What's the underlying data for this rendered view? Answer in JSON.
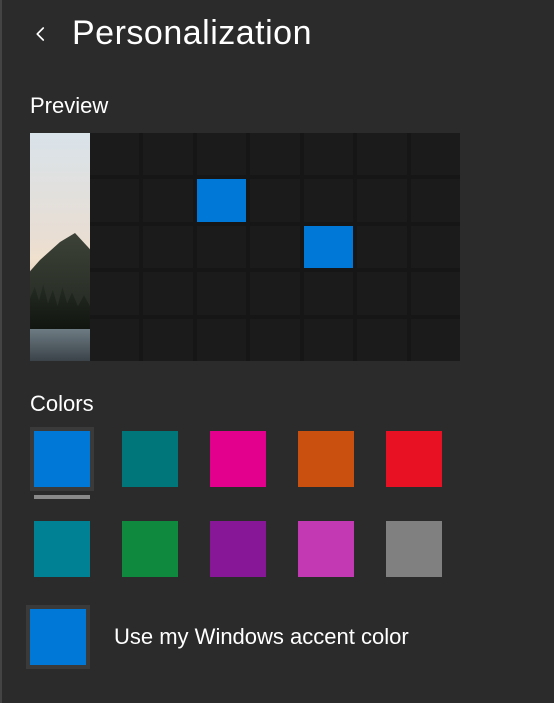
{
  "header": {
    "title": "Personalization"
  },
  "sections": {
    "preview_label": "Preview",
    "colors_label": "Colors"
  },
  "preview": {
    "grid": {
      "cols": 7,
      "rows": 5
    },
    "lit_cells": [
      [
        1,
        2
      ],
      [
        2,
        4
      ]
    ],
    "accent": "#0078d7"
  },
  "colors": {
    "row1": [
      {
        "name": "blue",
        "hex": "#0078d7",
        "selected": true,
        "underline": true
      },
      {
        "name": "teal",
        "hex": "#00757a",
        "selected": false,
        "underline": false
      },
      {
        "name": "magenta",
        "hex": "#e3008c",
        "selected": false,
        "underline": false
      },
      {
        "name": "orange",
        "hex": "#ca5010",
        "selected": false,
        "underline": false
      },
      {
        "name": "red",
        "hex": "#e81123",
        "selected": false,
        "underline": false
      }
    ],
    "row2": [
      {
        "name": "darkteal",
        "hex": "#008294",
        "selected": false
      },
      {
        "name": "green",
        "hex": "#0f893e",
        "selected": false
      },
      {
        "name": "purple",
        "hex": "#881798",
        "selected": false
      },
      {
        "name": "pink",
        "hex": "#c239b3",
        "selected": false
      },
      {
        "name": "gray",
        "hex": "#808080",
        "selected": false
      }
    ]
  },
  "accent_option": {
    "label": "Use my Windows accent color",
    "hex": "#0078d7"
  }
}
